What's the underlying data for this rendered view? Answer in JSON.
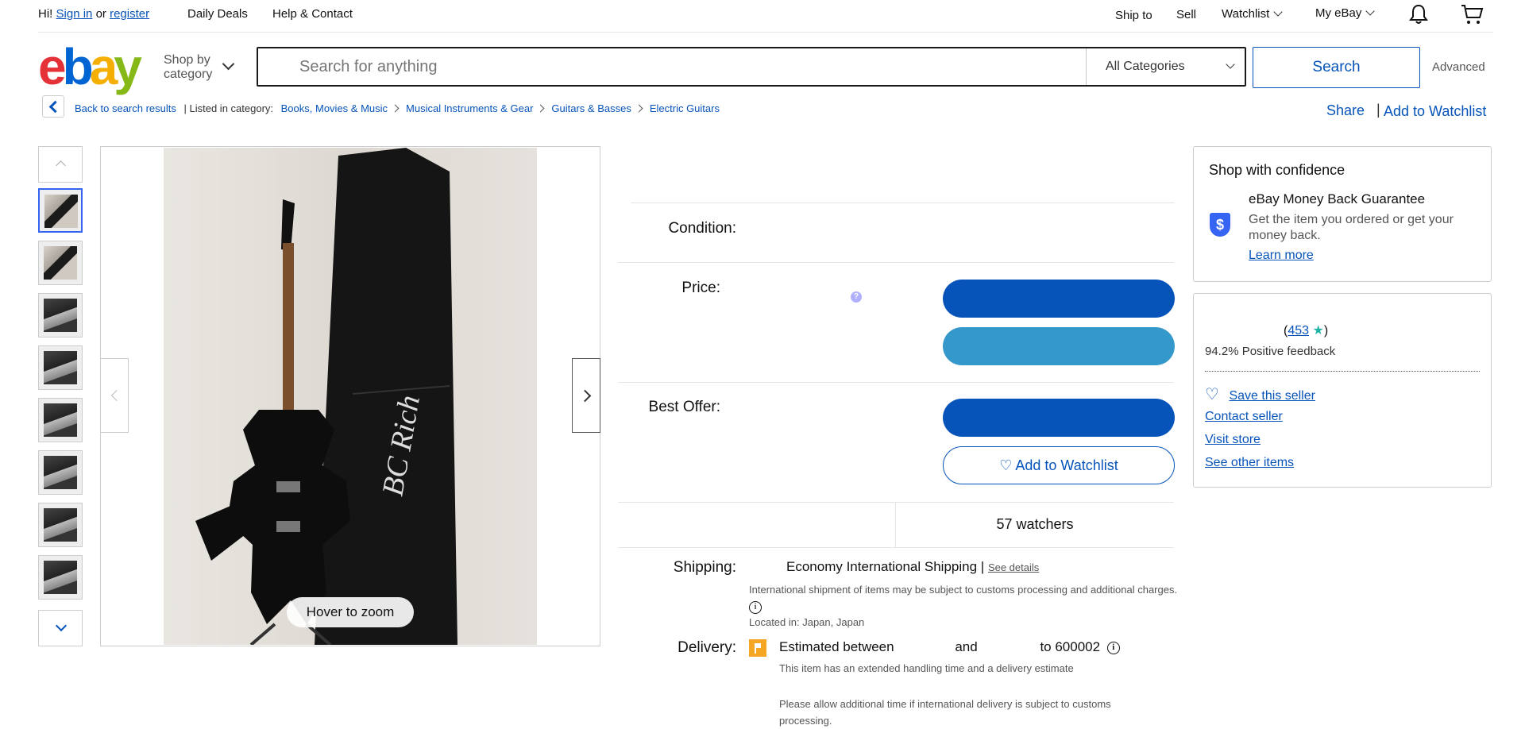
{
  "topbar": {
    "greeting": "Hi!",
    "sign_in": "Sign in",
    "or": "or",
    "register": "register",
    "daily_deals": "Daily Deals",
    "help_contact": "Help & Contact",
    "ship_to": "Ship to",
    "sell": "Sell",
    "watchlist": "Watchlist",
    "my_ebay": "My eBay"
  },
  "header": {
    "logo_letters": [
      "e",
      "b",
      "a",
      "y"
    ],
    "shop_by_line1": "Shop by",
    "shop_by_line2": "category",
    "search_placeholder": "Search for anything",
    "category_selected": "All Categories",
    "search_button": "Search",
    "advanced": "Advanced"
  },
  "breadcrumb": {
    "back": "Back to search results",
    "listed_in": "| Listed in category:",
    "items": [
      "Books, Movies & Music",
      "Musical Instruments & Gear",
      "Guitars & Basses",
      "Electric Guitars"
    ],
    "share": "Share",
    "divider": "|",
    "add_to_watchlist": "Add to Watchlist"
  },
  "gallery": {
    "hover_to_zoom": "Hover to zoom",
    "thumb_count": 8,
    "selected_index": 0,
    "case_brand_text": "BC Rich"
  },
  "item": {
    "condition_label": "Condition:",
    "price_label": "Price:",
    "price_help": "?",
    "best_offer_label": "Best Offer:",
    "add_to_watchlist_button": "Add to Watchlist",
    "watchers": "57 watchers",
    "shipping_label": "Shipping:",
    "shipping_method": "Economy International Shipping",
    "shipping_sep": "|",
    "see_details": "See details",
    "intl_note": "International shipment of items may be subject to customs processing and additional charges.",
    "located_in": "Located in: Japan, Japan",
    "delivery_label": "Delivery:",
    "estimated_between": "Estimated between",
    "and": "and",
    "to_zip": "to 600002",
    "handling_note": "This item has an extended handling time and a delivery estimate",
    "customs_note": "Please allow additional time if international delivery is subject to customs processing."
  },
  "confidence": {
    "title": "Shop with confidence",
    "guarantee_title": "eBay Money Back Guarantee",
    "guarantee_text": "Get the item you ordered or get your money back.",
    "learn_more": "Learn more"
  },
  "seller": {
    "open_paren": "(",
    "feedback_count": "453",
    "close_paren": ")",
    "positive": "94.2% Positive feedback",
    "save_seller": "Save this seller",
    "contact_seller": "Contact seller",
    "visit_store": "Visit store",
    "see_other_items": "See other items"
  },
  "colors": {
    "link": "#0654ba",
    "primary_button": "#0654ba",
    "secondary_button": "#3498ca",
    "star": "#1eb5a6"
  }
}
